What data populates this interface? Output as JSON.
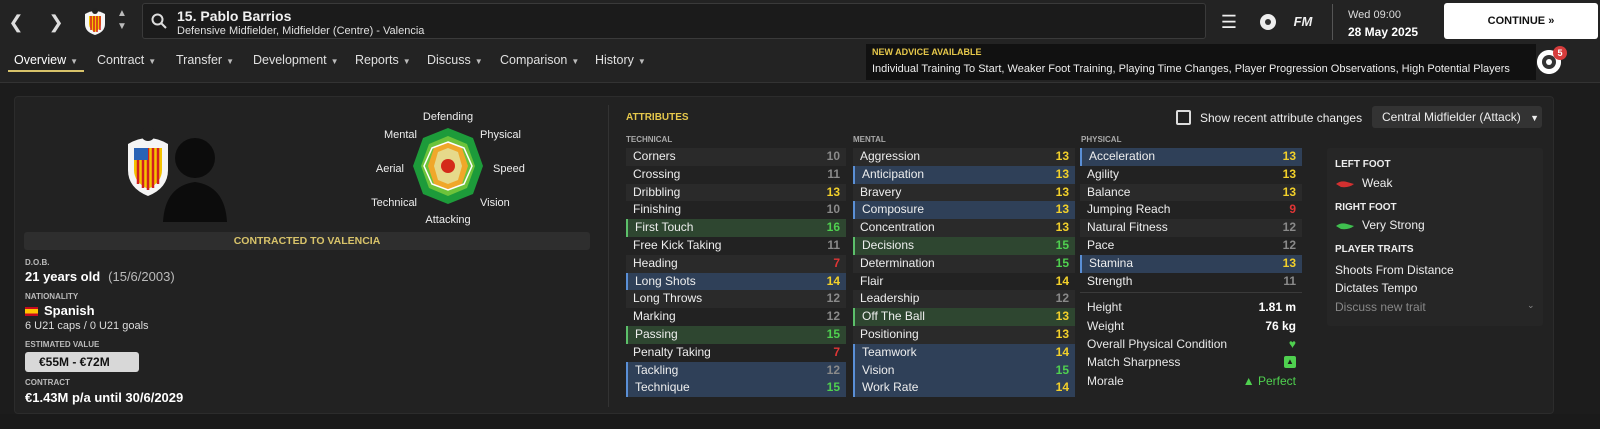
{
  "header": {
    "player_title": "15. Pablo Barrios",
    "player_subtitle": "Defensive Midfielder, Midfielder (Centre) - Valencia",
    "fm_label": "FM",
    "date_day": "Wed 09:00",
    "date_full": "28 May 2025",
    "continue_label": "CONTINUE",
    "icons": [
      "back-arrow-icon",
      "forward-arrow-icon",
      "club-crest-icon",
      "up-down-icon",
      "search-icon",
      "menu-icon",
      "football-icon",
      "fm-logo-icon",
      "chevron-right-icon"
    ]
  },
  "tabs": [
    {
      "label": "Overview"
    },
    {
      "label": "Contract"
    },
    {
      "label": "Transfer"
    },
    {
      "label": "Development"
    },
    {
      "label": "Reports"
    },
    {
      "label": "Discuss"
    },
    {
      "label": "Comparison"
    },
    {
      "label": "History"
    }
  ],
  "advice": {
    "title": "NEW ADVICE AVAILABLE",
    "text": "Individual Training To Start, Weaker Foot Training, Playing Time Changes, Player Progression Observations, High Potential Players",
    "badge_count": "5"
  },
  "radar": {
    "labels": [
      "Defending",
      "Physical",
      "Speed",
      "Vision",
      "Attacking",
      "Technical",
      "Aerial",
      "Mental"
    ]
  },
  "profile": {
    "contract_banner": "CONTRACTED TO VALENCIA",
    "dob_label": "D.O.B.",
    "age": "21 years old",
    "dob": "(15/6/2003)",
    "nationality_label": "NATIONALITY",
    "nationality": "Spanish",
    "caps": "6 U21 caps / 0 U21 goals",
    "value_label": "ESTIMATED VALUE",
    "value": "€55M - €72M",
    "contract_label": "CONTRACT",
    "contract": "€1.43M p/a until 30/6/2029"
  },
  "attributes": {
    "title": "ATTRIBUTES",
    "show_changes_label": "Show recent attribute changes",
    "role": "Central Midfielder (Attack)",
    "technical_label": "TECHNICAL",
    "mental_label": "MENTAL",
    "physical_label": "PHYSICAL",
    "colors": {
      "high": "#f2d02a",
      "mid": "#8a8a8a",
      "green": "#4fd04f",
      "red": "#e03535"
    },
    "technical": [
      {
        "name": "Corners",
        "value": "10",
        "hl": ""
      },
      {
        "name": "Crossing",
        "value": "11",
        "hl": ""
      },
      {
        "name": "Dribbling",
        "value": "13",
        "hl": ""
      },
      {
        "name": "Finishing",
        "value": "10",
        "hl": ""
      },
      {
        "name": "First Touch",
        "value": "16",
        "hl": "green"
      },
      {
        "name": "Free Kick Taking",
        "value": "11",
        "hl": ""
      },
      {
        "name": "Heading",
        "value": "7",
        "hl": ""
      },
      {
        "name": "Long Shots",
        "value": "14",
        "hl": "blue"
      },
      {
        "name": "Long Throws",
        "value": "12",
        "hl": ""
      },
      {
        "name": "Marking",
        "value": "12",
        "hl": ""
      },
      {
        "name": "Passing",
        "value": "15",
        "hl": "green"
      },
      {
        "name": "Penalty Taking",
        "value": "7",
        "hl": ""
      },
      {
        "name": "Tackling",
        "value": "12",
        "hl": "blue"
      },
      {
        "name": "Technique",
        "value": "15",
        "hl": "blue"
      }
    ],
    "mental": [
      {
        "name": "Aggression",
        "value": "13",
        "hl": ""
      },
      {
        "name": "Anticipation",
        "value": "13",
        "hl": "blue"
      },
      {
        "name": "Bravery",
        "value": "13",
        "hl": ""
      },
      {
        "name": "Composure",
        "value": "13",
        "hl": "blue"
      },
      {
        "name": "Concentration",
        "value": "13",
        "hl": ""
      },
      {
        "name": "Decisions",
        "value": "15",
        "hl": "green"
      },
      {
        "name": "Determination",
        "value": "15",
        "hl": ""
      },
      {
        "name": "Flair",
        "value": "14",
        "hl": ""
      },
      {
        "name": "Leadership",
        "value": "12",
        "hl": ""
      },
      {
        "name": "Off The Ball",
        "value": "13",
        "hl": "green"
      },
      {
        "name": "Positioning",
        "value": "13",
        "hl": ""
      },
      {
        "name": "Teamwork",
        "value": "14",
        "hl": "blue"
      },
      {
        "name": "Vision",
        "value": "15",
        "hl": "blue"
      },
      {
        "name": "Work Rate",
        "value": "14",
        "hl": "blue"
      }
    ],
    "physical": [
      {
        "name": "Acceleration",
        "value": "13",
        "hl": "blue"
      },
      {
        "name": "Agility",
        "value": "13",
        "hl": ""
      },
      {
        "name": "Balance",
        "value": "13",
        "hl": ""
      },
      {
        "name": "Jumping Reach",
        "value": "9",
        "hl": ""
      },
      {
        "name": "Natural Fitness",
        "value": "12",
        "hl": ""
      },
      {
        "name": "Pace",
        "value": "12",
        "hl": ""
      },
      {
        "name": "Stamina",
        "value": "13",
        "hl": "blue"
      },
      {
        "name": "Strength",
        "value": "11",
        "hl": ""
      }
    ],
    "extra": {
      "height_label": "Height",
      "height": "1.81 m",
      "weight_label": "Weight",
      "weight": "76 kg",
      "condition_label": "Overall Physical Condition",
      "sharpness_label": "Match Sharpness",
      "morale_label": "Morale",
      "morale": "Perfect"
    }
  },
  "side": {
    "left_foot_label": "LEFT FOOT",
    "left_foot": "Weak",
    "right_foot_label": "RIGHT FOOT",
    "right_foot": "Very Strong",
    "traits_label": "PLAYER TRAITS",
    "traits": [
      "Shoots From Distance",
      "Dictates Tempo"
    ],
    "discuss_trait": "Discuss new trait"
  }
}
